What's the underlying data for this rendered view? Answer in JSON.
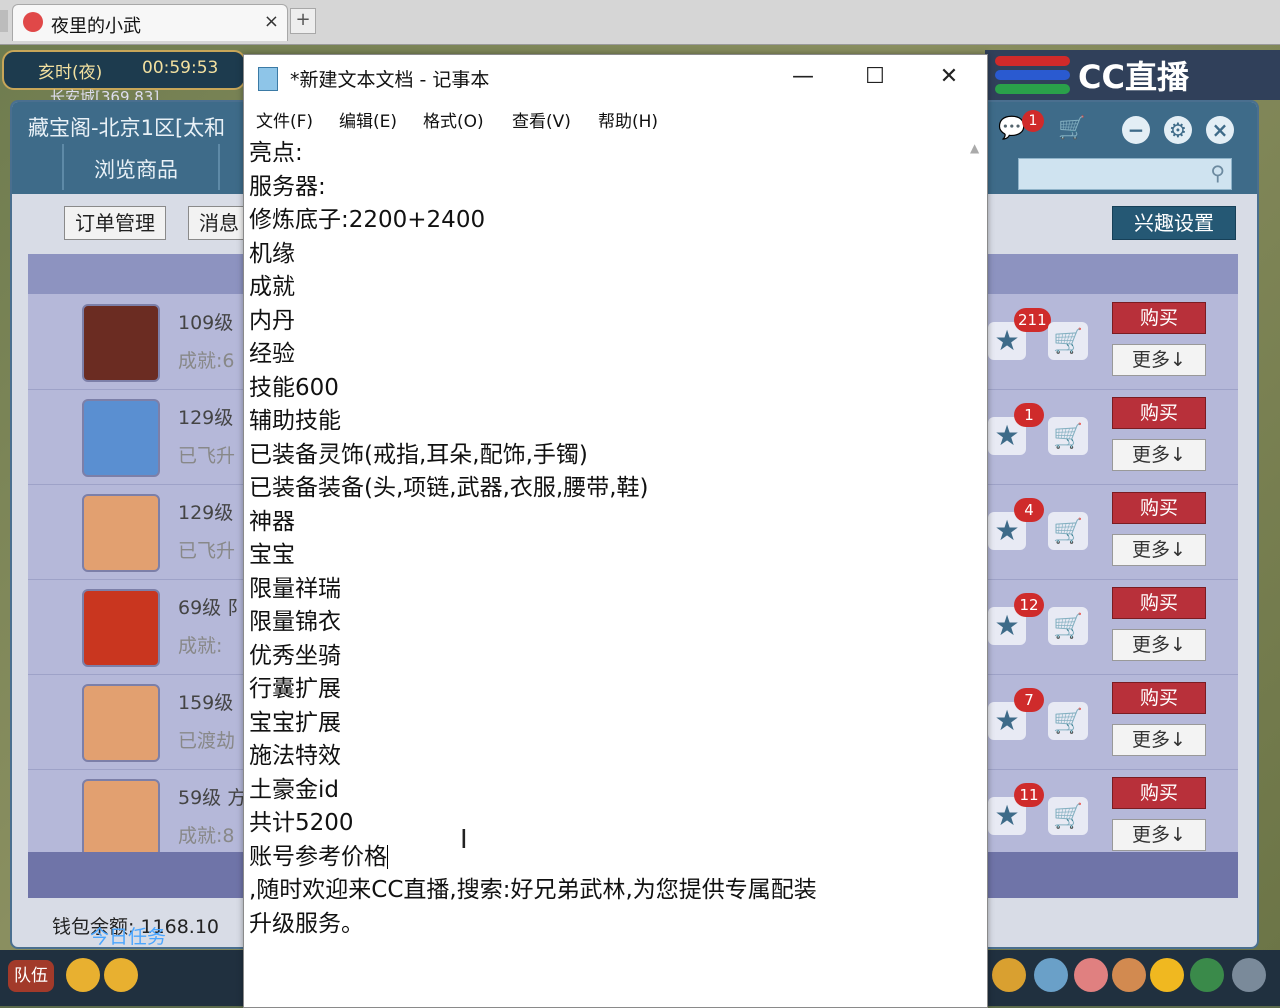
{
  "browser": {
    "tab_title": "夜里的小武",
    "tab_close": "×",
    "new_tab": "+"
  },
  "game": {
    "time_label": "亥时(夜)",
    "time_value": "00:59:53",
    "city": "长安城[369,83]",
    "cc_logo": "CC直播",
    "team_label": "队伍"
  },
  "shop": {
    "title": "藏宝阁-北京1区[太和",
    "browse_label": "浏览商品",
    "order_button": "订单管理",
    "message_button": "消息",
    "interest_button": "兴趣设置",
    "chat_badge": "1",
    "wallet": "钱包余额: 1168.10",
    "daily_task": "今日任务",
    "rows": [
      {
        "level": "109级",
        "sub": "成就:6",
        "badge": "211",
        "avatar_color": "#6b2c22"
      },
      {
        "level": "129级",
        "sub": "已飞升",
        "badge": "1",
        "avatar_color": "#5a8fd1"
      },
      {
        "level": "129级",
        "sub": "已飞升",
        "badge": "4",
        "avatar_color": "#e2a070"
      },
      {
        "level": "69级  阝",
        "sub": "成就:",
        "badge": "12",
        "avatar_color": "#c9361f"
      },
      {
        "level": "159级",
        "sub": "已渡劫",
        "badge": "7",
        "avatar_color": "#e2a070"
      },
      {
        "level": "59级  方",
        "sub": "成就:8",
        "badge": "11",
        "avatar_color": "#e2a070"
      }
    ],
    "buy_label": "购买",
    "more_label": "更多↓"
  },
  "notepad": {
    "title": "*新建文本文档 - 记事本",
    "menu": [
      "文件(F)",
      "编辑(E)",
      "格式(O)",
      "查看(V)",
      "帮助(H)"
    ],
    "lines": [
      "亮点:",
      "服务器:",
      "修炼底子:2200+2400",
      "机缘",
      "成就",
      "内丹",
      "经验",
      "技能600",
      "辅助技能",
      "已装备灵饰(戒指,耳朵,配饰,手镯)",
      "已装备装备(头,项链,武器,衣服,腰带,鞋)",
      "神器",
      "宝宝",
      "限量祥瑞",
      "限量锦衣",
      "优秀坐骑",
      "行囊扩展",
      "宝宝扩展",
      "施法特效",
      "土豪金id",
      "共计5200",
      "账号参考价格",
      ",随时欢迎来CC直播,搜索:好兄弟武林,为您提供专属配装",
      "升级服务。"
    ]
  }
}
